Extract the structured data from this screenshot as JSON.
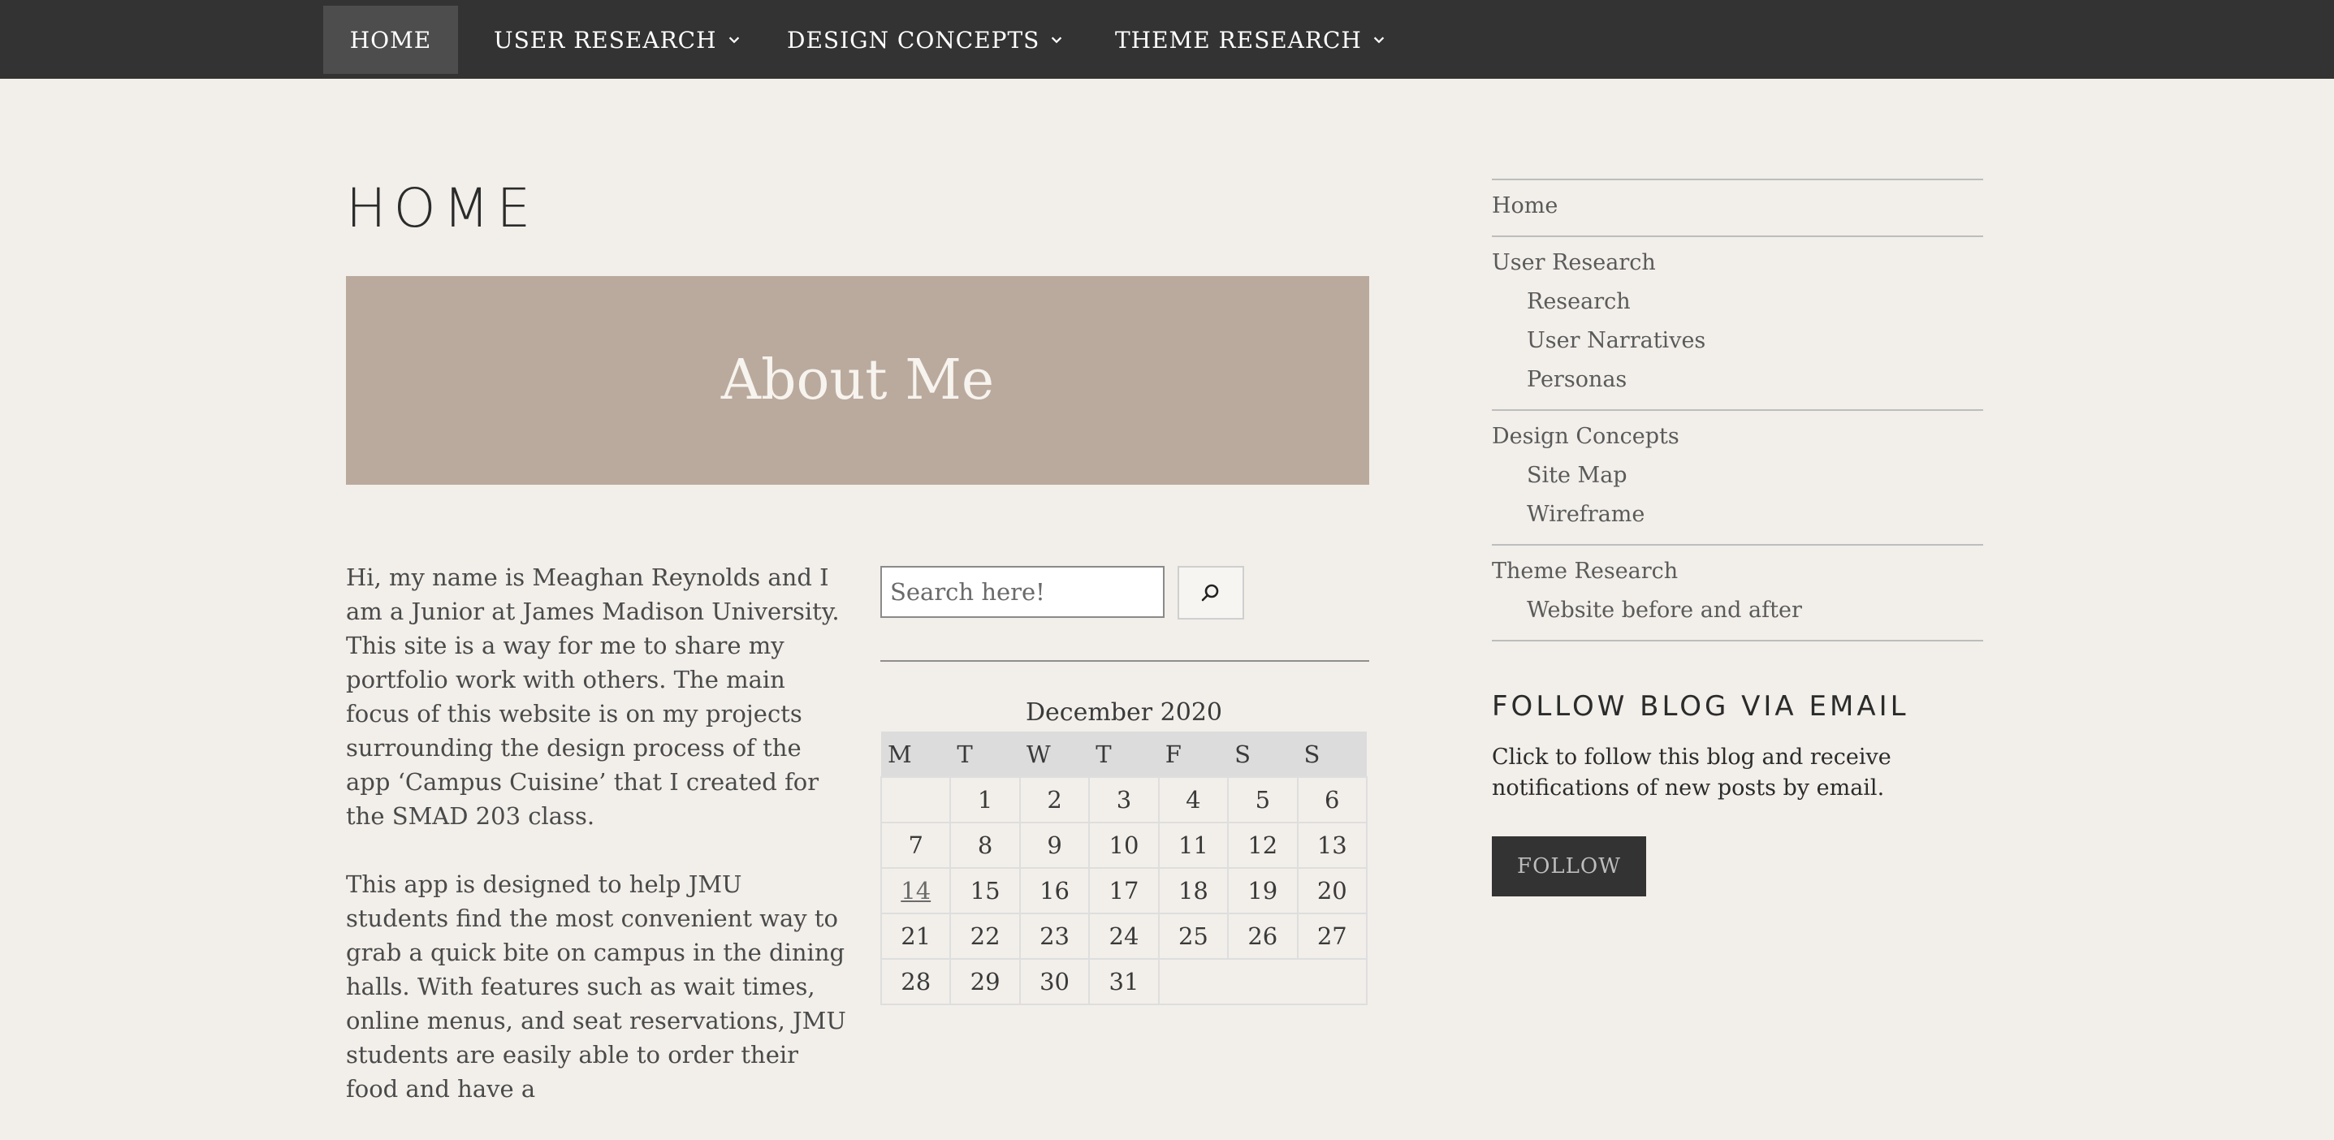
{
  "nav": {
    "items": [
      {
        "label": "HOME",
        "active": true,
        "dropdown": false
      },
      {
        "label": "USER RESEARCH",
        "active": false,
        "dropdown": true
      },
      {
        "label": "DESIGN CONCEPTS",
        "active": false,
        "dropdown": true
      },
      {
        "label": "THEME RESEARCH",
        "active": false,
        "dropdown": true
      }
    ]
  },
  "page": {
    "title": "HOME",
    "banner_title": "About Me",
    "paragraphs": [
      "Hi, my name is Meaghan Reynolds and I am a Junior at James Madison University. This site is a way for me to share my portfolio work with others. The main focus of this website is on my projects surrounding the design process of the app ‘Campus Cuisine’ that I created for the SMAD 203 class.",
      "This app is designed to help JMU students find the most convenient way to grab a quick bite on campus in the dining halls. With features such as wait times, online menus, and seat reservations, JMU students are easily able to order their food and have a"
    ]
  },
  "search": {
    "placeholder": "Search here!",
    "icon": "search-icon"
  },
  "calendar": {
    "caption": "December 2020",
    "weekdays": [
      "M",
      "T",
      "W",
      "T",
      "F",
      "S",
      "S"
    ],
    "weeks": [
      [
        "",
        "1",
        "2",
        "3",
        "4",
        "5",
        "6"
      ],
      [
        "7",
        "8",
        "9",
        "10",
        "11",
        "12",
        "13"
      ],
      [
        "14",
        "15",
        "16",
        "17",
        "18",
        "19",
        "20"
      ],
      [
        "21",
        "22",
        "23",
        "24",
        "25",
        "26",
        "27"
      ],
      [
        "28",
        "29",
        "30",
        "31",
        "",
        "",
        ""
      ]
    ],
    "linked_day": "14"
  },
  "sidebar": {
    "groups": [
      {
        "label": "Home",
        "children": []
      },
      {
        "label": "User Research",
        "children": [
          "Research",
          "User Narratives",
          "Personas"
        ]
      },
      {
        "label": "Design Concepts",
        "children": [
          "Site Map",
          "Wireframe"
        ]
      },
      {
        "label": "Theme Research",
        "children": [
          "Website before and after"
        ]
      }
    ]
  },
  "follow": {
    "heading": "FOLLOW BLOG VIA EMAIL",
    "text": "Click to follow this blog and receive notifications of new posts by email.",
    "button_label": "FOLLOW"
  },
  "colors": {
    "nav_bg": "#333333",
    "page_bg": "#f2efea",
    "banner_bg": "#baaa9d",
    "button_bg": "#333333"
  }
}
